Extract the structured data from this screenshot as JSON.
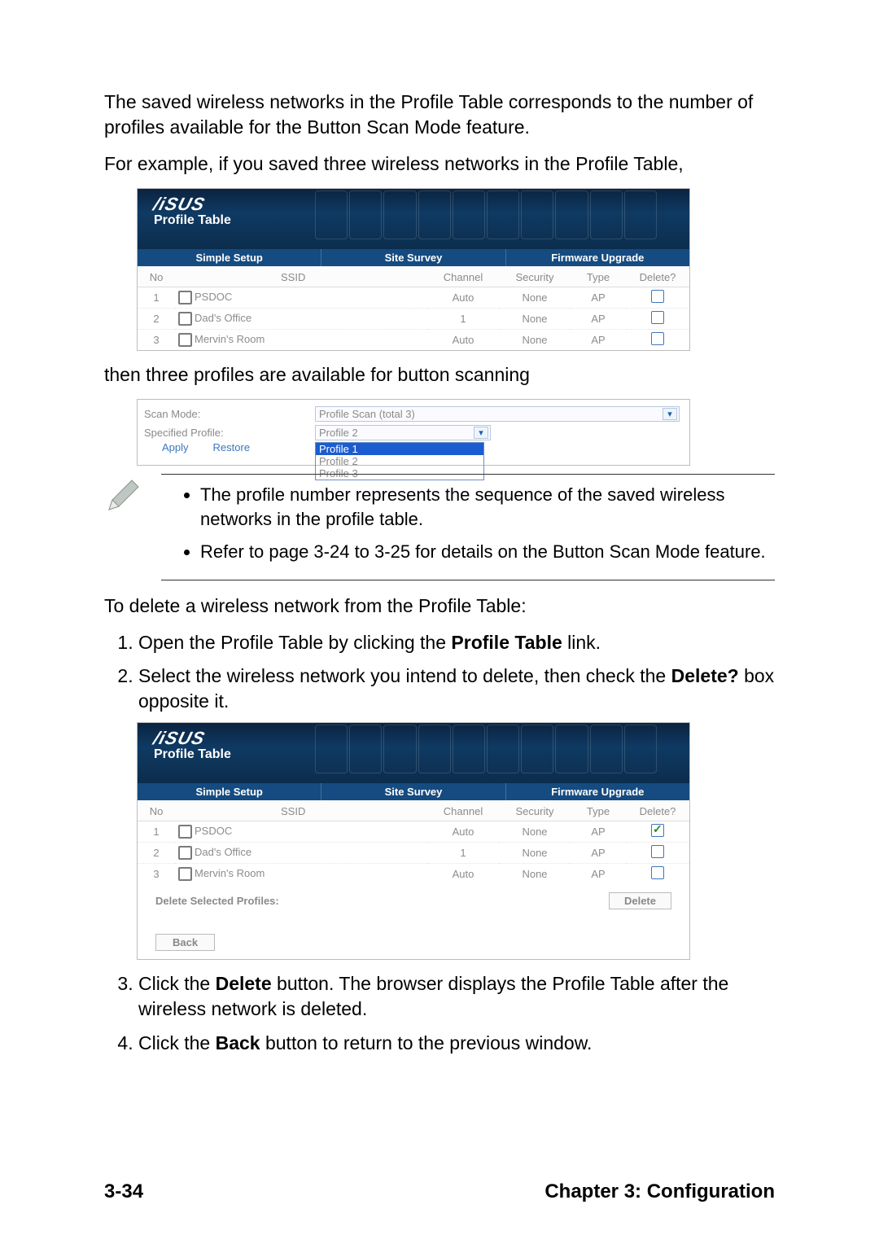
{
  "para1": "The saved wireless networks in the Profile Table corresponds to the number of profiles available for the Button Scan Mode feature.",
  "para2": "For example, if you saved three wireless networks in the Profile Table,",
  "para3": "then three profiles are available for button scanning",
  "para4": "To delete a wireless network from the Profile Table:",
  "step3": " button. The browser displays the Profile Table after the wireless network is deleted.",
  "step4": " button to return to the previous window.",
  "step1a": "Open the Profile Table by clicking the ",
  "step1b": " link.",
  "step2a": "Select the wireless network you intend to delete, then check the ",
  "step2b": " box opposite it.",
  "bold": {
    "profile_table": "Profile Table",
    "delete_q": "Delete?",
    "delete": "Delete",
    "back": "Back"
  },
  "step3a": "Click the ",
  "step4a": "Click the ",
  "profile_header": {
    "brand": "/iSUS",
    "title": "Profile Table",
    "tabs": [
      "Simple Setup",
      "Site Survey",
      "Firmware Upgrade"
    ]
  },
  "table_headers": {
    "no": "No",
    "ssid": "SSID",
    "channel": "Channel",
    "security": "Security",
    "type": "Type",
    "delete": "Delete?"
  },
  "table1_rows": [
    {
      "no": "1",
      "ssid": "PSDOC",
      "channel": "Auto",
      "security": "None",
      "type": "AP",
      "checked": false
    },
    {
      "no": "2",
      "ssid": "Dad's Office",
      "channel": "1",
      "security": "None",
      "type": "AP",
      "checked": false
    },
    {
      "no": "3",
      "ssid": "Mervin's Room",
      "channel": "Auto",
      "security": "None",
      "type": "AP",
      "checked": false
    }
  ],
  "scan_panel": {
    "scan_mode_label": "Scan Mode:",
    "scan_mode_value": "Profile Scan (total 3)",
    "spec_profile_label": "Specified Profile:",
    "spec_profile_value": "Profile 2",
    "options": [
      "Profile 1",
      "Profile 2",
      "Profile 3"
    ],
    "apply": "Apply",
    "restore": "Restore"
  },
  "notes": [
    "The profile number represents the sequence of the saved wireless networks in the profile table.",
    "Refer to page 3-24 to 3-25 for details on the Button Scan Mode feature."
  ],
  "table2_rows": [
    {
      "no": "1",
      "ssid": "PSDOC",
      "channel": "Auto",
      "security": "None",
      "type": "AP",
      "checked": true
    },
    {
      "no": "2",
      "ssid": "Dad's Office",
      "channel": "1",
      "security": "None",
      "type": "AP",
      "checked": false
    },
    {
      "no": "3",
      "ssid": "Mervin's Room",
      "channel": "Auto",
      "security": "None",
      "type": "AP",
      "checked": false
    }
  ],
  "delete_section": {
    "label": "Delete Selected Profiles:",
    "button": "Delete",
    "back": "Back"
  },
  "footer": {
    "page": "3-34",
    "chapter": "Chapter 3: Configuration"
  }
}
